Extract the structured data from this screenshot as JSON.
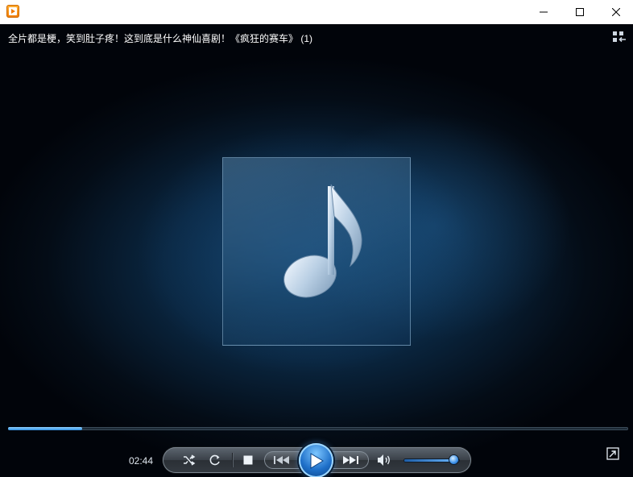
{
  "window": {
    "icon": "media-player-app-icon",
    "controls": [
      "minimize-icon",
      "maximize-icon",
      "close-icon"
    ]
  },
  "media": {
    "title": "全片都是梗，笑到肚子疼！这到底是什么神仙喜剧！《疯狂的赛车》 (1)",
    "album_art_icon": "music-note-icon",
    "elapsed_time": "02:44",
    "progress_fraction": 0.12,
    "volume_fraction": 0.9
  },
  "controls": {
    "layout_toggle_icon": "switch-to-library-icon",
    "shuffle_icon": "shuffle-icon",
    "repeat_icon": "repeat-icon",
    "stop_icon": "stop-icon",
    "previous_icon": "previous-track-icon",
    "play_icon": "play-icon",
    "next_icon": "next-track-icon",
    "volume_icon": "speaker-icon",
    "fullscreen_icon": "popout-icon"
  },
  "colors": {
    "accent": "#2f8fe0",
    "background_top": "#103a5c",
    "title_bar": "#ffffff"
  }
}
